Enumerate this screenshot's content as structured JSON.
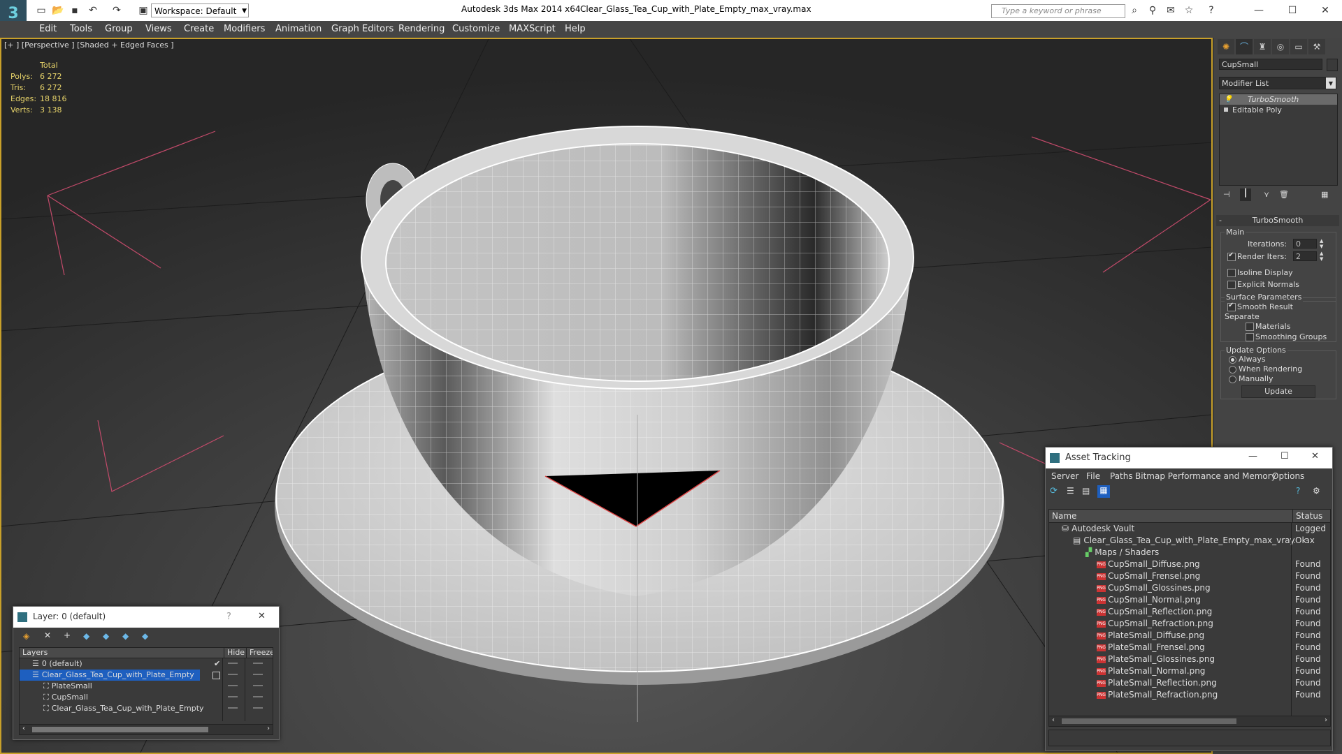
{
  "titlebar": {
    "app_title": "Autodesk 3ds Max  2014 x64",
    "file_title": "Clear_Glass_Tea_Cup_with_Plate_Empty_max_vray.max",
    "workspace_label": "Workspace: Default",
    "search_placeholder": "Type a keyword or phrase"
  },
  "menu": [
    "Edit",
    "Tools",
    "Group",
    "Views",
    "Create",
    "Modifiers",
    "Animation",
    "Graph Editors",
    "Rendering",
    "Customize",
    "MAXScript",
    "Help"
  ],
  "viewport": {
    "label": "[+ ] [Perspective ] [Shaded + Edged Faces ]",
    "stats": {
      "header": "Total",
      "rows": [
        {
          "label": "Polys:",
          "value": "6 272"
        },
        {
          "label": "Tris:",
          "value": "6 272"
        },
        {
          "label": "Edges:",
          "value": "18 816"
        },
        {
          "label": "Verts:",
          "value": "3 138"
        }
      ]
    }
  },
  "command_panel": {
    "object_name": "CupSmall",
    "modifier_list": "Modifier List",
    "stack": [
      "TurboSmooth",
      "Editable Poly"
    ],
    "rollout_title": "TurboSmooth",
    "main_label": "Main",
    "iterations_label": "Iterations:",
    "iterations_value": "0",
    "render_iters_label": "Render Iters:",
    "render_iters_value": "2",
    "isoline_label": "Isoline Display",
    "explicit_normals_label": "Explicit Normals",
    "surface_params_label": "Surface Parameters",
    "smooth_result_label": "Smooth Result",
    "separate_label": "Separate",
    "materials_label": "Materials",
    "smoothing_groups_label": "Smoothing Groups",
    "update_options_label": "Update Options",
    "always_label": "Always",
    "when_rendering_label": "When Rendering",
    "manually_label": "Manually",
    "update_button": "Update"
  },
  "asset_tracking": {
    "title": "Asset Tracking",
    "menu": [
      "Server",
      "File",
      "Paths",
      "Bitmap Performance and Memory",
      "Options"
    ],
    "col_name": "Name",
    "col_status": "Status",
    "rows": [
      {
        "name": "Autodesk Vault",
        "status": "Logged O"
      },
      {
        "name": "Clear_Glass_Tea_Cup_with_Plate_Empty_max_vray.max",
        "status": "Ok"
      },
      {
        "name": "Maps / Shaders",
        "status": ""
      },
      {
        "name": "CupSmall_Diffuse.png",
        "status": "Found"
      },
      {
        "name": "CupSmall_Frensel.png",
        "status": "Found"
      },
      {
        "name": "CupSmall_Glossines.png",
        "status": "Found"
      },
      {
        "name": "CupSmall_Normal.png",
        "status": "Found"
      },
      {
        "name": "CupSmall_Reflection.png",
        "status": "Found"
      },
      {
        "name": "CupSmall_Refraction.png",
        "status": "Found"
      },
      {
        "name": "PlateSmall_Diffuse.png",
        "status": "Found"
      },
      {
        "name": "PlateSmall_Frensel.png",
        "status": "Found"
      },
      {
        "name": "PlateSmall_Glossines.png",
        "status": "Found"
      },
      {
        "name": "PlateSmall_Normal.png",
        "status": "Found"
      },
      {
        "name": "PlateSmall_Reflection.png",
        "status": "Found"
      },
      {
        "name": "PlateSmall_Refraction.png",
        "status": "Found"
      }
    ]
  },
  "layer_panel": {
    "title": "Layer: 0 (default)",
    "help": "?",
    "col_layers": "Layers",
    "col_hide": "Hide",
    "col_freeze": "Freeze",
    "rows": [
      {
        "name": "0 (default)"
      },
      {
        "name": "Clear_Glass_Tea_Cup_with_Plate_Empty"
      },
      {
        "name": "PlateSmall"
      },
      {
        "name": "CupSmall"
      },
      {
        "name": "Clear_Glass_Tea_Cup_with_Plate_Empty"
      }
    ]
  },
  "colors": {
    "viewport_border": "#c8a02a",
    "selection": "#1e5fbf",
    "stats_text": "#e8d46a"
  }
}
